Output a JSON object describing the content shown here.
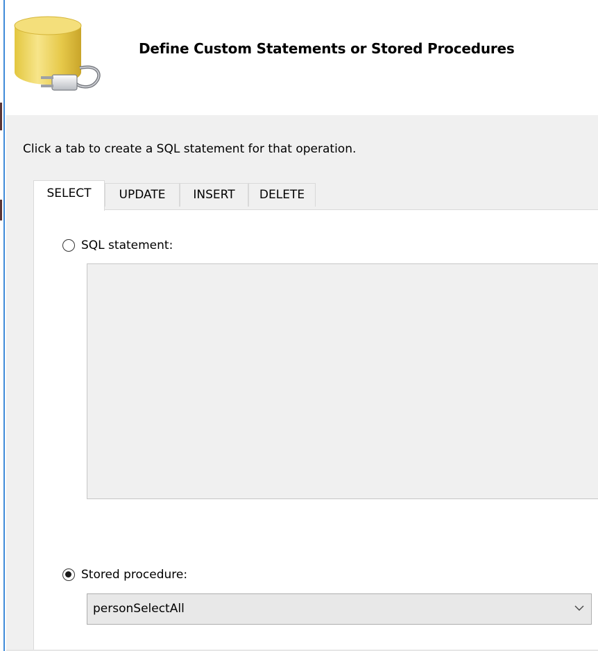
{
  "header": {
    "title": "Define Custom Statements or Stored Procedures",
    "icon": "database-plug-icon"
  },
  "instruction": "Click a tab to create a SQL statement for that operation.",
  "tabs": [
    {
      "label": "SELECT",
      "active": true
    },
    {
      "label": "UPDATE",
      "active": false
    },
    {
      "label": "INSERT",
      "active": false
    },
    {
      "label": "DELETE",
      "active": false
    }
  ],
  "sql_statement": {
    "label": "SQL statement:",
    "selected": false,
    "value": ""
  },
  "stored_procedure": {
    "label": "Stored procedure:",
    "selected": true,
    "value": "personSelectAll"
  },
  "colors": {
    "panel_background": "#f0f0f0",
    "accent_edge": "#3d8ad8"
  }
}
